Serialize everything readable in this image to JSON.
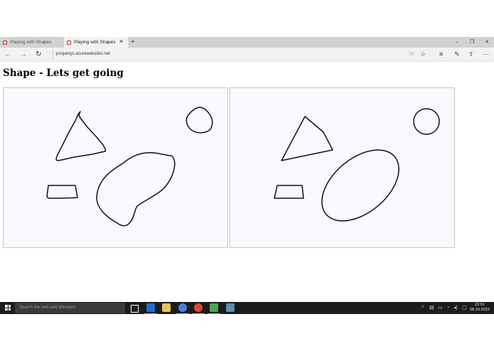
{
  "browser": {
    "tabs": [
      {
        "label": "Playing with Shapes",
        "active": false
      },
      {
        "label": "Playing with Shapes",
        "active": true
      }
    ],
    "new_tab": "+",
    "window": {
      "minimize": "–",
      "restore": "❐",
      "close": "✕"
    },
    "url": "poojamys.azurewebsites.net",
    "nav": {
      "back": "←",
      "forward": "→",
      "refresh": "↻"
    },
    "tools": {
      "reading_view": "▯▯",
      "favorite": "☆",
      "hub": "≡",
      "note": "✎",
      "share": "⇧",
      "more": "···"
    }
  },
  "page": {
    "title": "Shape - Lets get going",
    "colors": {
      "canvas_bg": "#f8f8fd",
      "canvas_border": "#c6c6cc",
      "stroke": "#111111"
    }
  },
  "taskbar": {
    "search_placeholder": "Search the web and Windows",
    "apps": [
      "task-view",
      "edge",
      "file-explorer",
      "media",
      "chrome",
      "excel",
      "network-app"
    ],
    "tray": {
      "chevron": "^",
      "icons": [
        "network",
        "volume",
        "battery",
        "action-center"
      ]
    },
    "time": "22:51",
    "date": "28-10-2015"
  }
}
